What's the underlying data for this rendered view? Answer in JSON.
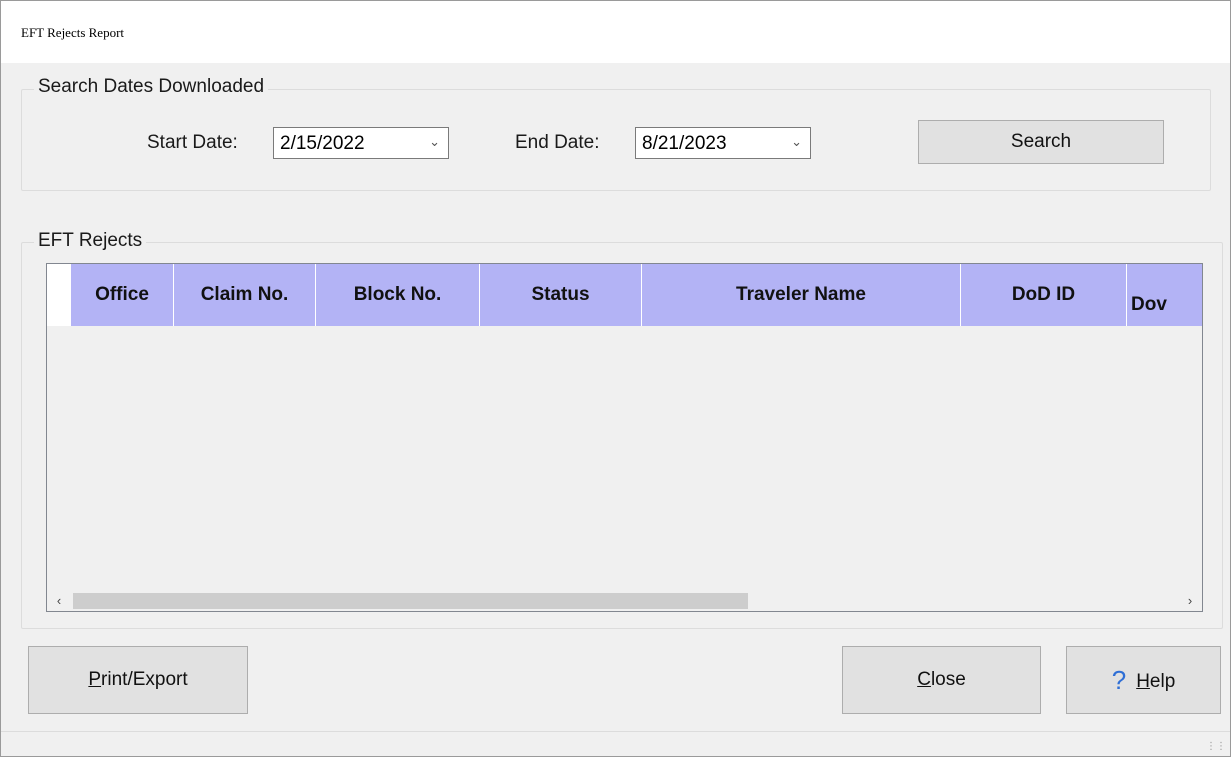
{
  "window": {
    "title": "EFT Rejects Report"
  },
  "search_group": {
    "label": "Search Dates Downloaded",
    "start_label": "Start Date:",
    "start_value": "2/15/2022",
    "end_label": "End Date:",
    "end_value": "8/21/2023",
    "search_button": "Search"
  },
  "rejects_group": {
    "label": "EFT Rejects",
    "columns": [
      "Office",
      "Claim No.",
      "Block No.",
      "Status",
      "Traveler Name",
      "DoD ID",
      "Dov"
    ],
    "header_color": "#b3b3f5"
  },
  "scrollbar": {
    "left_arrow": "‹",
    "right_arrow": "›"
  },
  "buttons": {
    "print_export_mnemonic": "P",
    "print_export_rest": "rint/Export",
    "close_mnemonic": "C",
    "close_rest": "lose",
    "help_icon": "?",
    "help_mnemonic": "H",
    "help_rest": "elp"
  }
}
